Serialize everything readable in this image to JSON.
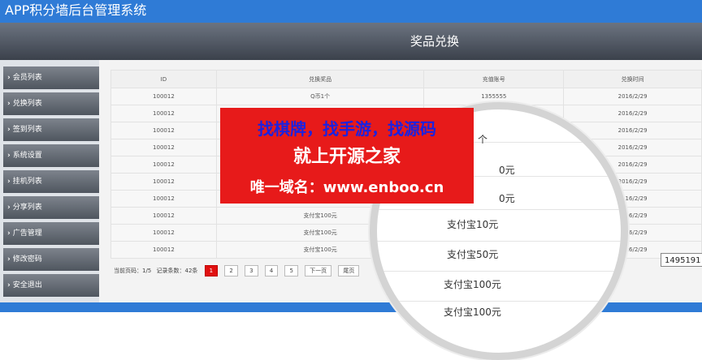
{
  "app": {
    "title": "APP积分墙后台管理系统"
  },
  "page": {
    "heading": "奖品兑换"
  },
  "sidebar": {
    "items": [
      {
        "label": "会员列表"
      },
      {
        "label": "兑换列表"
      },
      {
        "label": "签到列表"
      },
      {
        "label": "系统设置"
      },
      {
        "label": "挂机列表"
      },
      {
        "label": "分享列表"
      },
      {
        "label": "广告管理"
      },
      {
        "label": "修改密码"
      },
      {
        "label": "安全退出"
      }
    ]
  },
  "table": {
    "columns": [
      "ID",
      "兑换奖品",
      "充值账号",
      "兑换时间"
    ],
    "rows": [
      [
        "100012",
        "Q币1个",
        "1355555",
        "2016/2/29"
      ],
      [
        "100012",
        "",
        "",
        "2016/2/29"
      ],
      [
        "100012",
        "",
        "",
        "2016/2/29"
      ],
      [
        "100012",
        "",
        "",
        "2016/2/29"
      ],
      [
        "100012",
        "",
        "",
        "2016/2/29"
      ],
      [
        "100012",
        "",
        "",
        "2016/2/29"
      ],
      [
        "100012",
        "支付宝100元",
        "",
        "2016/2/29"
      ],
      [
        "100012",
        "支付宝100元",
        "",
        "2016/2/29"
      ],
      [
        "100012",
        "支付宝100元",
        "",
        "2016/2/29"
      ],
      [
        "100012",
        "支付宝100元",
        "",
        "2016/2/29"
      ]
    ]
  },
  "pager": {
    "current_label": "当前页码：1/5",
    "count_label": "记录条数：42条",
    "pages": [
      "1",
      "2",
      "3",
      "4",
      "5"
    ],
    "next": "下一页",
    "last": "尾页"
  },
  "magnifier": {
    "items": [
      "个",
      "0元",
      "0元",
      "支付宝10元",
      "支付宝50元",
      "支付宝100元",
      "支付宝100元"
    ]
  },
  "ad": {
    "line1": "找棋牌，找手游，找源码",
    "line2": "就上开源之家",
    "line3": "唯一域名：www.enboo.cn"
  },
  "tooltip": {
    "text": "1495191"
  },
  "colors": {
    "topbar": "#2f7bd6",
    "ad_bg": "#e71a1a",
    "ad_line1": "#1b22e0",
    "active_page": "#e01010"
  }
}
